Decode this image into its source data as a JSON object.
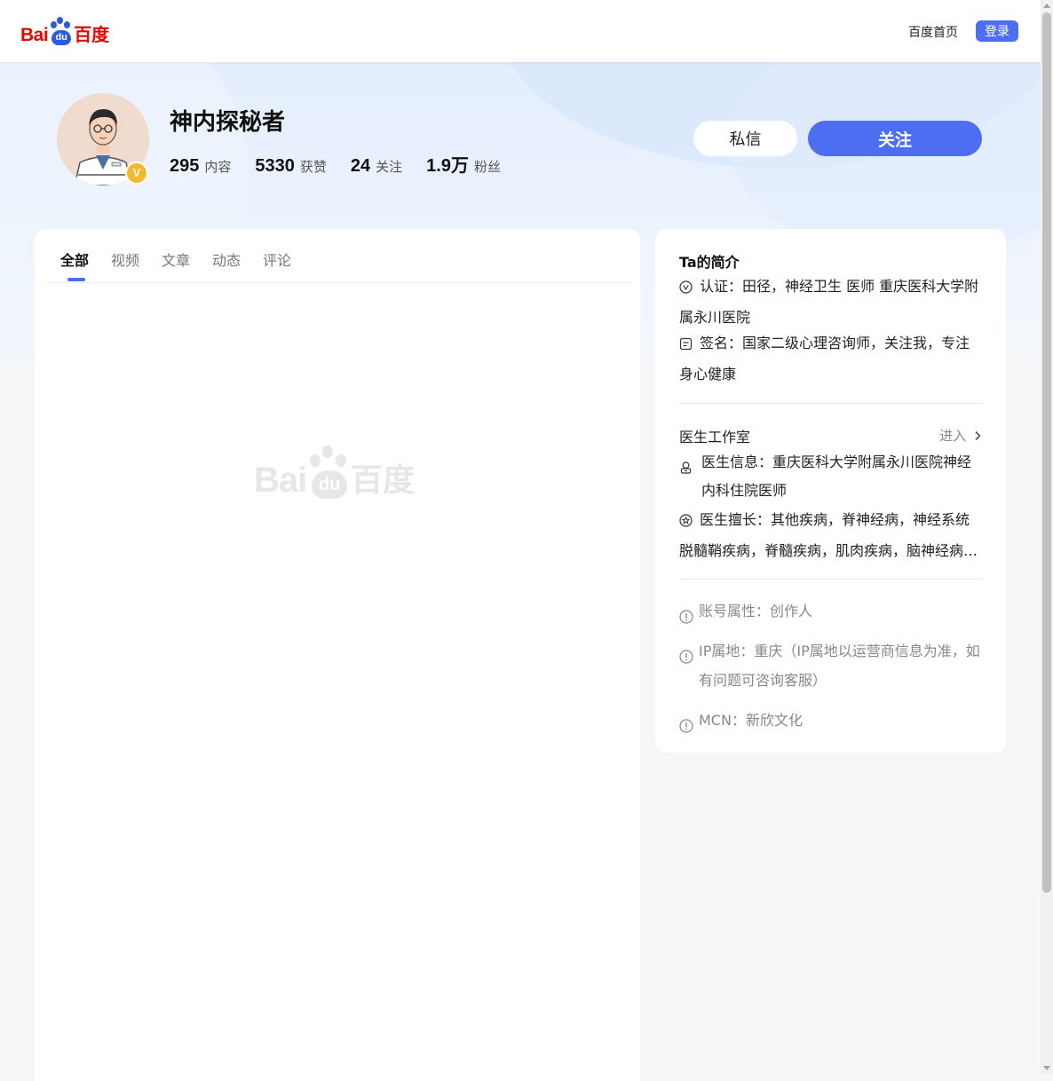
{
  "header": {
    "logo_text_latin": "Bai",
    "logo_text_paw": "du",
    "logo_text_cn": "百度",
    "home_link": "百度首页",
    "login_button": "登录"
  },
  "profile": {
    "name": "神内探秘者",
    "verified_badge": "V",
    "stats": [
      {
        "value": "295",
        "label": "内容"
      },
      {
        "value": "5330",
        "label": "获赞"
      },
      {
        "value": "24",
        "label": "关注"
      },
      {
        "value": "1.9万",
        "label": "粉丝"
      }
    ],
    "message_button": "私信",
    "follow_button": "关注"
  },
  "tabs": [
    {
      "label": "全部",
      "active": true
    },
    {
      "label": "视频",
      "active": false
    },
    {
      "label": "文章",
      "active": false
    },
    {
      "label": "动态",
      "active": false
    },
    {
      "label": "评论",
      "active": false
    }
  ],
  "watermark": {
    "latin": "Bai",
    "paw": "du",
    "cn": "百度"
  },
  "intro": {
    "title": "Ta的简介",
    "certification": "认证：田径，神经卫生 医师 重庆医科大学附属永川医院",
    "signature": "签名：国家二级心理咨询师，关注我，专注身心健康"
  },
  "studio": {
    "title": "医生工作室",
    "enter_link": "进入",
    "doctor_info": "医生信息：重庆医科大学附属永川医院神经内科住院医师",
    "specialty": "医生擅长：其他疾病，脊神经病，神经系统脱髓鞘疾病，脊髓疾病，肌肉疾病，脑神经病，周围神经病"
  },
  "account": {
    "attribute": "账号属性：创作人",
    "ip_location": "IP属地：重庆（IP属地以运营商信息为准，如有问题可咨询客服）",
    "mcn": "MCN：新欣文化"
  },
  "colors": {
    "accent": "#4e6ef2",
    "brand_red": "#e10602",
    "brand_blue": "#2d5be0",
    "badge": "#f5b82b"
  },
  "icons": [
    "baidu-logo",
    "verified-icon",
    "certification-icon",
    "signature-icon",
    "doctor-icon",
    "star-icon",
    "info-icon",
    "chevron-right-icon"
  ]
}
